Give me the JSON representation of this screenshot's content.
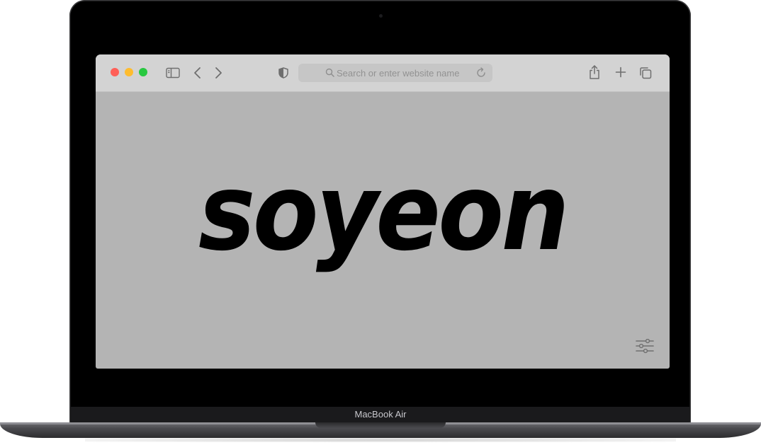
{
  "device": {
    "label": "MacBook Air"
  },
  "browser": {
    "window_controls": [
      "close",
      "minimize",
      "zoom"
    ],
    "address_bar": {
      "placeholder": "Search or enter website name",
      "value": ""
    },
    "toolbar_icons": [
      "sidebar-icon",
      "back-icon",
      "forward-icon",
      "shield-icon",
      "search-icon",
      "reload-icon",
      "share-icon",
      "plus-icon",
      "tabs-icon"
    ]
  },
  "page": {
    "hero_text": "soyeon",
    "settings_icon": "sliders-icon"
  },
  "colors": {
    "page_background": "#b4b4b4",
    "toolbar_background": "#d3d3d3",
    "close_dot": "#ff5f57",
    "minimize_dot": "#febc2e",
    "zoom_dot": "#28c840",
    "hero_text": "#000000"
  }
}
